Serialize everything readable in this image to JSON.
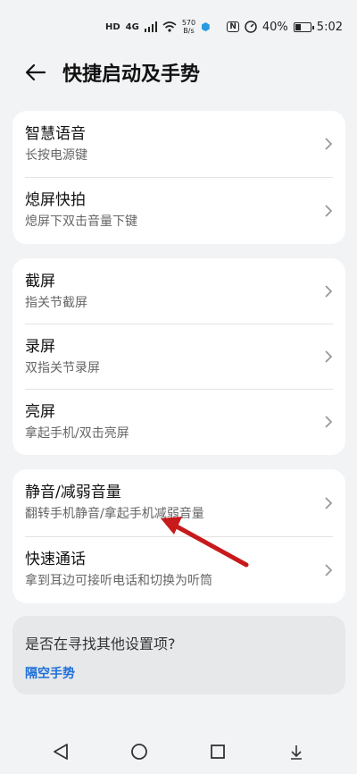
{
  "status_bar": {
    "hd_badge": "HD",
    "net_badge": "4G",
    "speed_value": "570",
    "speed_unit": "B/s",
    "nfc_badge": "N",
    "battery_percent": "40%",
    "battery_level": 0.4,
    "time": "5:02"
  },
  "header": {
    "title": "快捷启动及手势"
  },
  "groups": [
    {
      "items": [
        {
          "title": "智慧语音",
          "subtitle": "长按电源键"
        },
        {
          "title": "熄屏快拍",
          "subtitle": "熄屏下双击音量下键"
        }
      ]
    },
    {
      "items": [
        {
          "title": "截屏",
          "subtitle": "指关节截屏"
        },
        {
          "title": "录屏",
          "subtitle": "双指关节录屏"
        },
        {
          "title": "亮屏",
          "subtitle": "拿起手机/双击亮屏"
        }
      ]
    },
    {
      "items": [
        {
          "title": "静音/减弱音量",
          "subtitle": "翻转手机静音/拿起手机减弱音量"
        },
        {
          "title": "快速通话",
          "subtitle": "拿到耳边可接听电话和切换为听筒"
        }
      ]
    }
  ],
  "suggestion": {
    "question": "是否在寻找其他设置项?",
    "link": "隔空手势"
  },
  "colors": {
    "annotation_arrow": "#c8191b",
    "link": "#1e6fd9"
  }
}
